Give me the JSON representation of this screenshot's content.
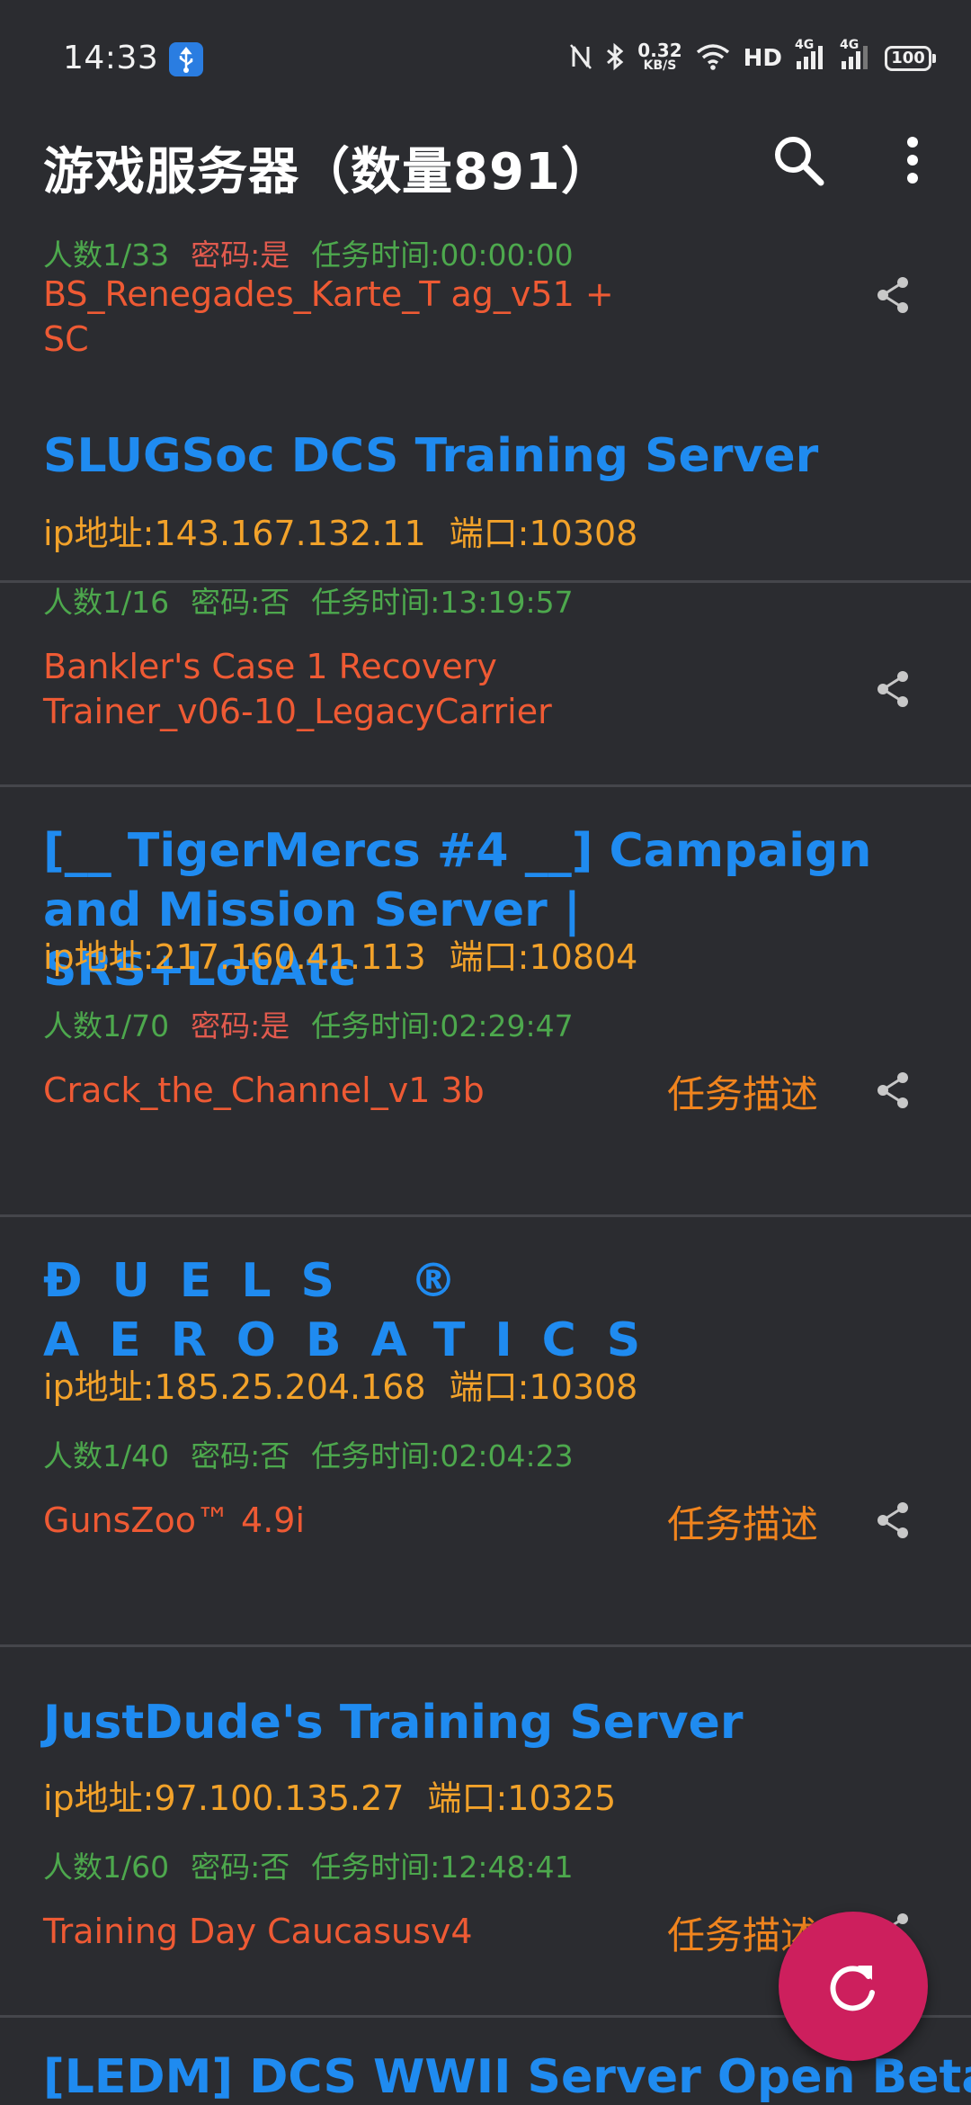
{
  "status_bar": {
    "time": "14:33",
    "speed_value": "0.32",
    "speed_unit": "KB/S",
    "network_label": "HD",
    "net_4g_1": "4G",
    "net_4g_2": "4G",
    "battery": "100",
    "icons": [
      "usb-icon",
      "nfc-off-icon",
      "bluetooth-icon",
      "wifi-icon",
      "signal-icon",
      "signal-icon"
    ]
  },
  "app_bar": {
    "title": "游戏服务器（数量891）",
    "icons": [
      "search-icon",
      "more-vert-icon"
    ]
  },
  "servers": [
    {
      "title": "",
      "ip": "",
      "port": "",
      "players": "人数1/33",
      "password": "密码:是",
      "mission_time": "任务时间:00:00:00",
      "mission": "BS_Renegades_Karte_T ag_v51 + SC",
      "description_button": ""
    },
    {
      "title": "SLUGSoc DCS Training Server",
      "ip": "ip地址:143.167.132.11",
      "port": "端口:10308",
      "players": "人数1/16",
      "password": "密码:否",
      "mission_time": "任务时间:13:19:57",
      "mission": "Bankler's Case 1 Recovery Trainer_v06-10_LegacyCarrier",
      "description_button": ""
    },
    {
      "title": "[__ TigerMercs #4 __] Campaign and Mission Server | SRS+LotAtc",
      "ip": "ip地址:217.160.41.113",
      "port": "端口:10804",
      "players": "人数1/70",
      "password": "密码:是",
      "mission_time": "任务时间:02:29:47",
      "mission": "Crack_the_Channel_v1 3b",
      "description_button": "任务描述"
    },
    {
      "title": "ĐUELS ® AEROBATICS",
      "ip": "ip地址:185.25.204.168",
      "port": "端口:10308",
      "players": "人数1/40",
      "password": "密码:否",
      "mission_time": "任务时间:02:04:23",
      "mission": "GunsZoo™ 4.9i",
      "description_button": "任务描述"
    },
    {
      "title": "JustDude's Training Server",
      "ip": "ip地址:97.100.135.27",
      "port": "端口:10325",
      "players": "人数1/60",
      "password": "密码:否",
      "mission_time": "任务时间:12:48:41",
      "mission": "Training Day Caucasusv4",
      "description_button": "任务描述"
    },
    {
      "title": "[LEDM] DCS WWII Server Open Beta",
      "ip": "",
      "port": "",
      "players": "",
      "password": "",
      "mission_time": "",
      "mission": "",
      "description_button": ""
    }
  ],
  "fab": {
    "icon": "refresh-icon"
  },
  "colors": {
    "background": "#2b2c30",
    "title_blue": "#1f8bf0",
    "ip_orange": "#f2a22a",
    "meta_green": "#4da84d",
    "password_yes_red": "#e15a4e",
    "mission_red": "#ee5a34",
    "description_orange": "#f0841e",
    "fab_pink": "#cd1f5d",
    "divider": "#45464b"
  }
}
